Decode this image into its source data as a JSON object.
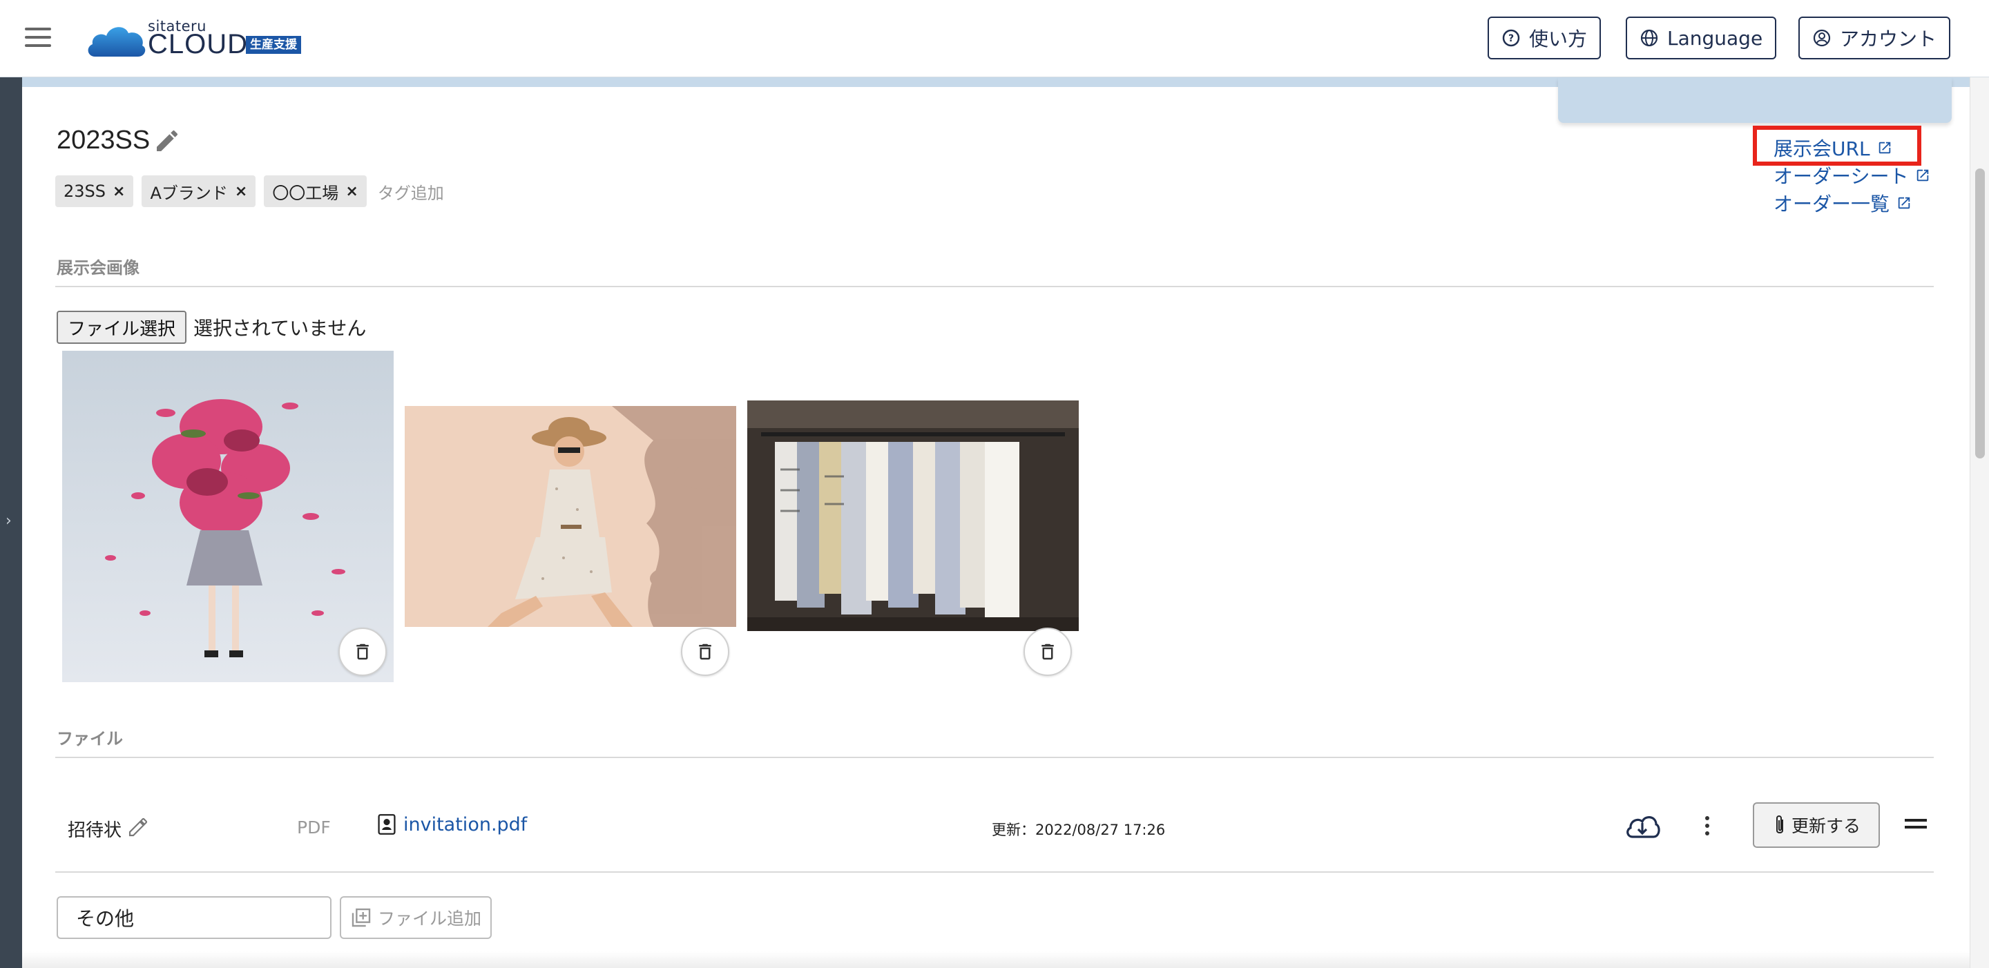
{
  "header": {
    "logo_small": "sitateru",
    "logo_main": "CLOUD",
    "logo_badge": "生産支援",
    "help_label": "使い方",
    "language_label": "Language",
    "account_label": "アカウント"
  },
  "page": {
    "title": "2023SS",
    "tags": [
      "23SS",
      "Aブランド",
      "〇〇工場"
    ],
    "tag_add_placeholder": "タグ追加",
    "links": {
      "exhibition_url": "展示会URL",
      "order_sheet": "オーダーシート",
      "order_list": "オーダー一覧"
    }
  },
  "images_section": {
    "label": "展示会画像",
    "file_button": "ファイル選択",
    "file_status": "選択されていません"
  },
  "files_section": {
    "label": "ファイル",
    "row": {
      "name": "招待状",
      "type": "PDF",
      "filename": "invitation.pdf",
      "updated": "更新：2022/08/27 17:26",
      "update_button": "更新する"
    },
    "other_input_value": "その他",
    "add_file_button": "ファイル追加"
  },
  "colors": {
    "accent": "#1b56a6",
    "header_text": "#1f2e4f",
    "highlight": "#e8241b",
    "panel_blue": "#c6d9ea"
  }
}
